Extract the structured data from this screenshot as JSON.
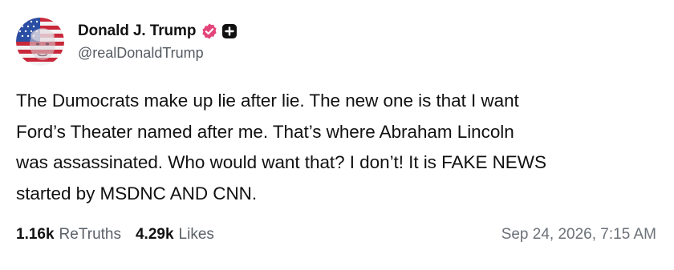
{
  "author": {
    "display_name": "Donald J. Trump",
    "handle": "@realDonaldTrump",
    "avatar_icon": "avatar-flag-portrait",
    "verified_icon": "verified-badge-icon",
    "verified_color": "#e3447a",
    "plus_icon": "plus-badge-icon"
  },
  "post": {
    "text_lines": [
      "The Dumocrats make up lie after lie. The new one is that I want",
      "Ford’s Theater named after me. That’s where Abraham Lincoln",
      "was assassinated. Who would want that? I don’t! It is FAKE NEWS",
      "started by MSDNC AND CNN."
    ]
  },
  "stats": {
    "retruths_count": "1.16k",
    "retruths_label": "ReTruths",
    "likes_count": "4.29k",
    "likes_label": "Likes"
  },
  "timestamp": "Sep 24, 2026, 7:15 AM",
  "colors": {
    "text": "#111111",
    "secondary": "#5b6168",
    "badge_pink": "#e3447a"
  }
}
